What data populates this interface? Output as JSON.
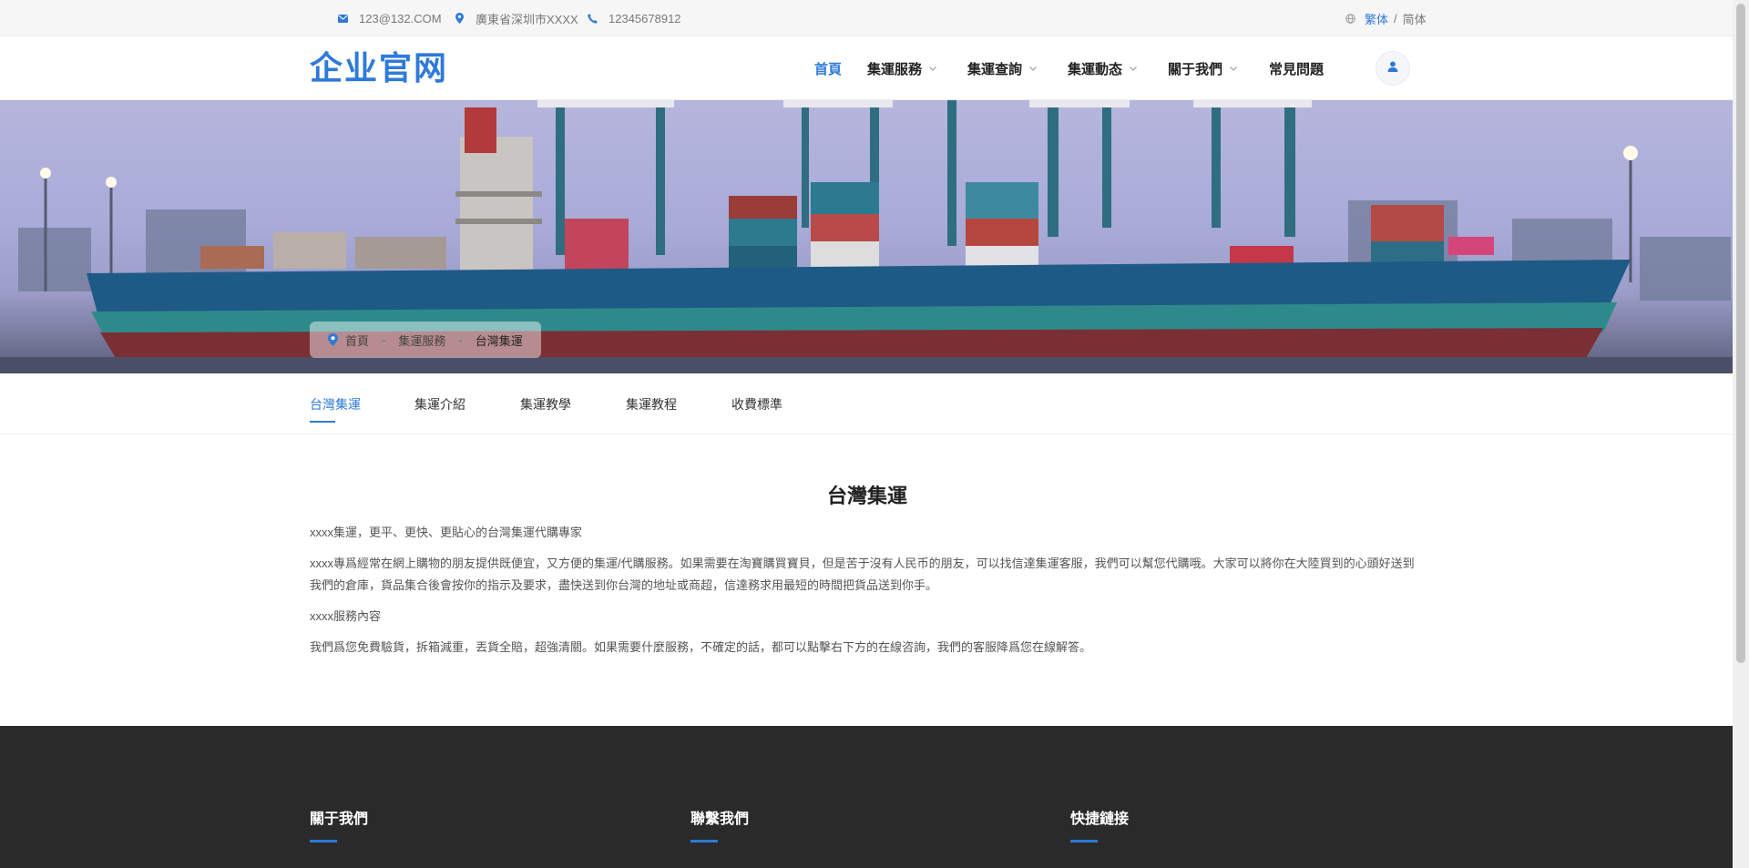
{
  "topbar": {
    "email": "123@132.COM",
    "address": "廣東省深圳市XXXX",
    "phone": "12345678912",
    "lang_active": "繁体",
    "lang_sep": "/",
    "lang_other": "简体"
  },
  "header": {
    "logo": "企业官网",
    "nav": [
      {
        "label": "首頁"
      },
      {
        "label": "集運服務"
      },
      {
        "label": "集運查詢"
      },
      {
        "label": "集運動态"
      },
      {
        "label": "關于我們"
      },
      {
        "label": "常見問題"
      }
    ],
    "chevron": "⌄"
  },
  "breadcrumb": {
    "items": [
      "首頁",
      "集運服務",
      "台灣集運"
    ],
    "sep": "-"
  },
  "tabs": [
    "台灣集運",
    "集運介紹",
    "集運教學",
    "集運教程",
    "收費標準"
  ],
  "content": {
    "title": "台灣集運",
    "paragraphs": [
      "xxxx集運，更平、更快、更貼心的台灣集運代購專家",
      "xxxx專爲經常在網上購物的朋友提供既便宜，又方便的集運/代購服務。如果需要在淘寶購買寶貝，但是苦于沒有人民币的朋友，可以找信達集運客服，我們可以幫您代購哦。大家可以將你在大陸買到的心頭好送到我們的倉庫，貨品集合後會按你的指示及要求，盡快送到你台灣的地址或商超，信達務求用最短的時間把貨品送到你手。",
      "xxxx服務內容",
      "我們爲您免費驗貨，拆箱減重，丟貨全賠，超強清關。如果需要什麼服務，不確定的話，都可以點擊右下方的在線咨詢，我們的客服降爲您在線解答。"
    ]
  },
  "footer": {
    "columns": [
      "關于我們",
      "聯繫我們",
      "快捷鏈接"
    ]
  },
  "colors": {
    "accent": "#2f7ad8",
    "footer_bg": "#2a2a2a"
  },
  "icons": [
    "mail-icon",
    "location-icon",
    "phone-icon",
    "globe-icon",
    "user-icon",
    "map-pin-icon"
  ]
}
